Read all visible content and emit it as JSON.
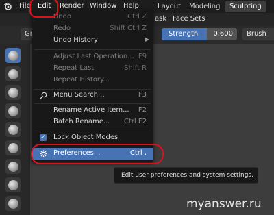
{
  "menubar": {
    "items": [
      "File",
      "Edit",
      "Render",
      "Window",
      "Help"
    ]
  },
  "workspaces": {
    "tabs": [
      "Layout",
      "Modeling",
      "Sculpting"
    ],
    "active": "Sculpting"
  },
  "header_bar": {
    "mask_label": "ask",
    "face_sets_label": "Face Sets"
  },
  "tool_settings": {
    "brush_name": "Gra",
    "strength_label": "Strength",
    "strength_value": "0.600",
    "strength_fraction": 0.6,
    "brush_dropdown": "Brush"
  },
  "edit_menu": {
    "items": [
      {
        "label": "Undo",
        "shortcut": "Ctrl Z",
        "enabled": false
      },
      {
        "label": "Redo",
        "shortcut": "Shift Ctrl Z",
        "enabled": false
      },
      {
        "label": "Undo History",
        "shortcut": "",
        "enabled": true,
        "submenu": true
      },
      {
        "label": "Adjust Last Operation...",
        "shortcut": "F9",
        "enabled": false
      },
      {
        "label": "Repeat Last",
        "shortcut": "Shift R",
        "enabled": false
      },
      {
        "label": "Repeat History...",
        "shortcut": "",
        "enabled": false
      },
      {
        "label": "Menu Search...",
        "shortcut": "F3",
        "enabled": true,
        "icon": "search-icon"
      },
      {
        "label": "Rename Active Item...",
        "shortcut": "F2",
        "enabled": true
      },
      {
        "label": "Batch Rename...",
        "shortcut": "Ctrl F2",
        "enabled": true
      },
      {
        "label": "Lock Object Modes",
        "shortcut": "",
        "enabled": true,
        "checked": true
      },
      {
        "label": "Preferences...",
        "shortcut": "Ctrl ,",
        "enabled": true,
        "highlighted": true,
        "icon": "gear-icon"
      }
    ]
  },
  "tooltip": {
    "text": "Edit user preferences and system settings."
  },
  "watermark": "myanswer.ru",
  "colors": {
    "accent": "#4772b3",
    "annotation": "#e0101a"
  }
}
